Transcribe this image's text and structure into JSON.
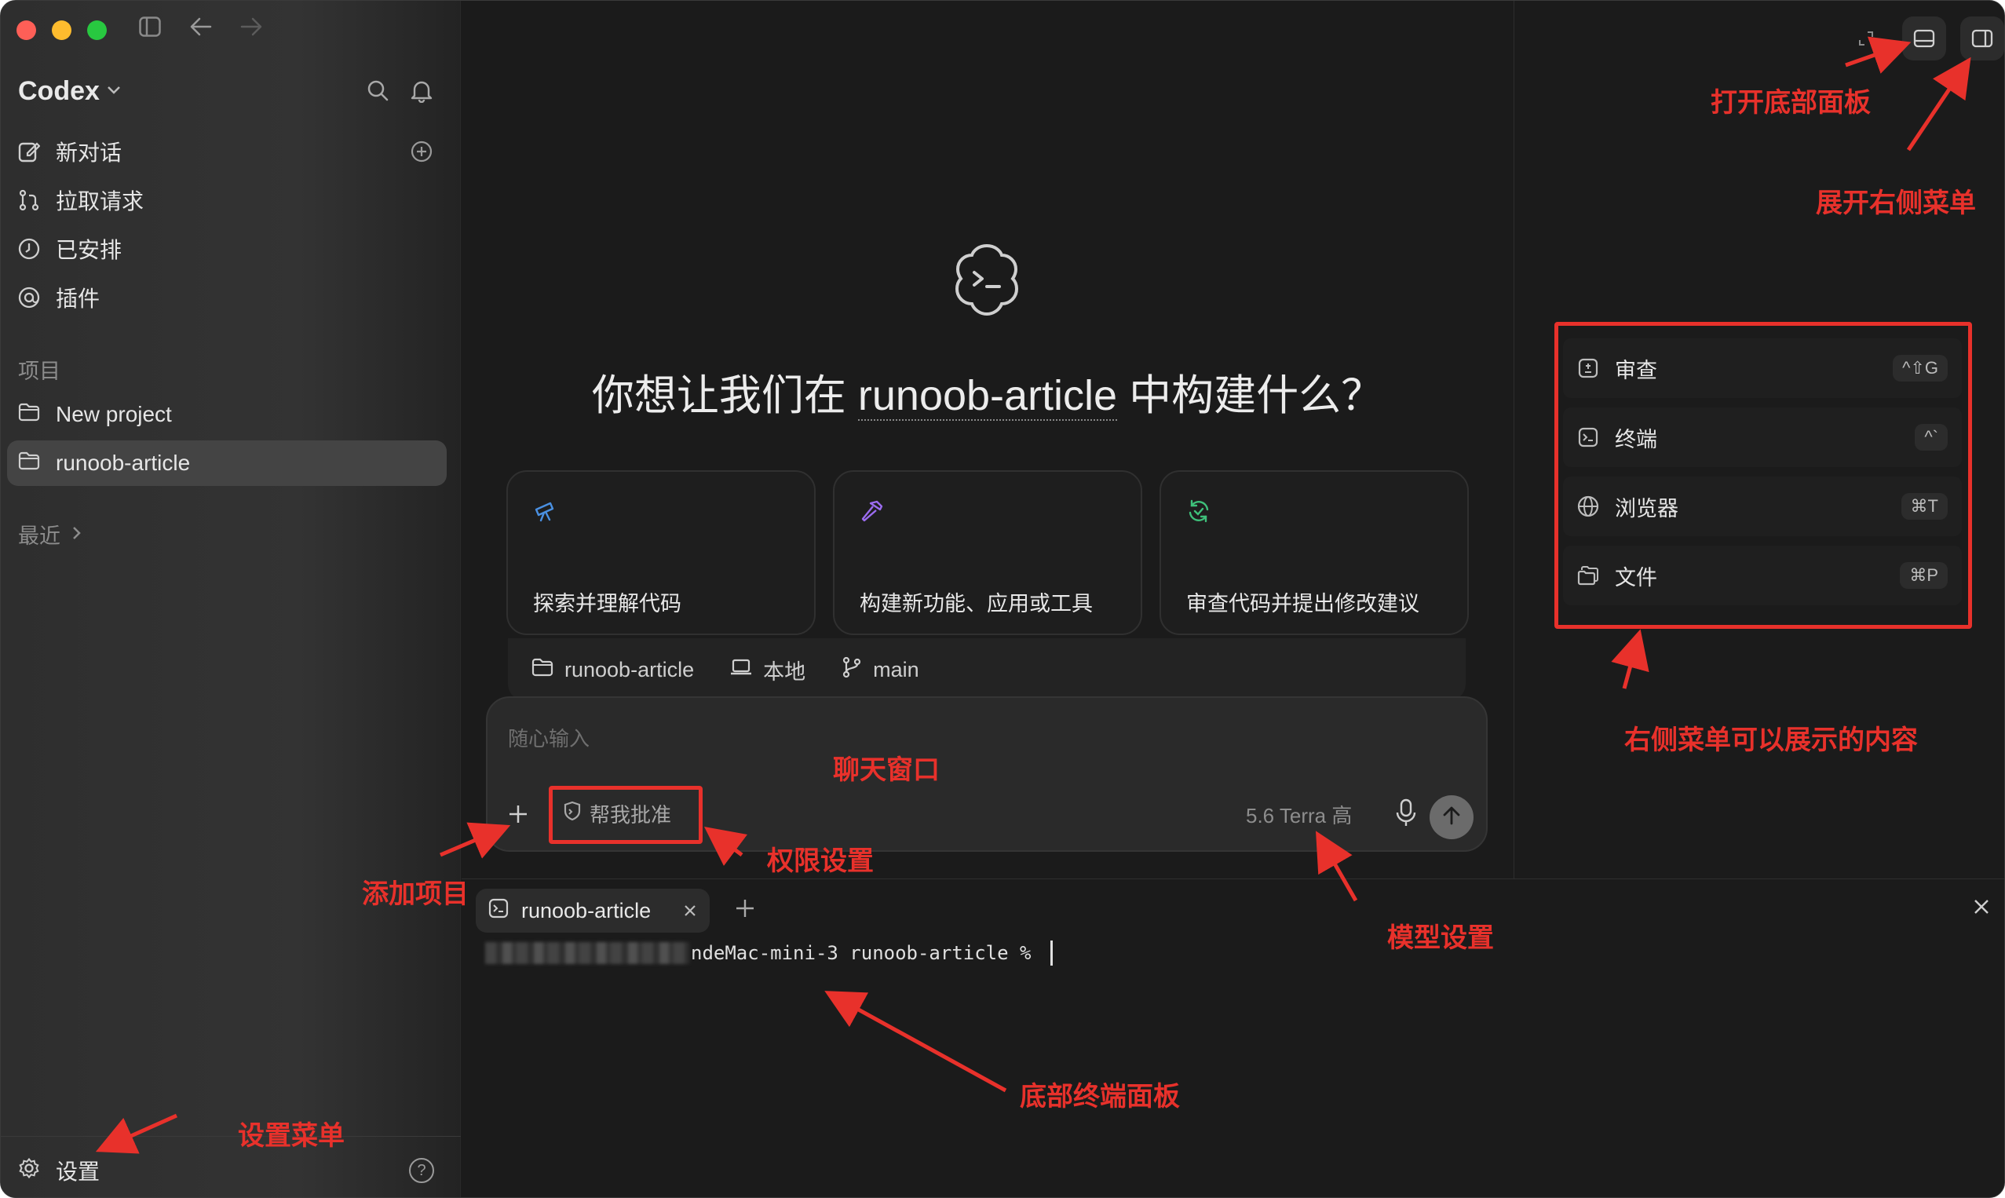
{
  "sidebar": {
    "app_name": "Codex",
    "nav": [
      {
        "label": "新对话",
        "icon": "edit-icon"
      },
      {
        "label": "拉取请求",
        "icon": "pull-request-icon"
      },
      {
        "label": "已安排",
        "icon": "clock-icon"
      },
      {
        "label": "插件",
        "icon": "plugin-icon"
      }
    ],
    "projects_label": "项目",
    "projects": [
      {
        "name": "New project",
        "active": false
      },
      {
        "name": "runoob-article",
        "active": true
      }
    ],
    "recent_label": "最近",
    "settings_label": "设置",
    "help_glyph": "?"
  },
  "main": {
    "headline_prefix": "你想让我们在 ",
    "headline_project": "runoob-article",
    "headline_suffix": " 中构建什么？",
    "cards": [
      {
        "label": "探索并理解代码",
        "icon": "telescope-icon",
        "color": "#4a90e2"
      },
      {
        "label": "构建新功能、应用或工具",
        "icon": "hammer-icon",
        "color": "#9b6cf0"
      },
      {
        "label": "审查代码并提出修改建议",
        "icon": "refresh-check-icon",
        "color": "#3ec07a"
      }
    ],
    "context": {
      "project": "runoob-article",
      "environment": "本地",
      "branch": "main"
    },
    "composer": {
      "placeholder": "随心输入",
      "approve_label": "帮我批准",
      "model_label": "5.6 Terra 高"
    }
  },
  "right_panel": {
    "menu": [
      {
        "label": "审查",
        "icon": "review-icon",
        "shortcut": "^⇧G"
      },
      {
        "label": "终端",
        "icon": "terminal-icon",
        "shortcut": "^`"
      },
      {
        "label": "浏览器",
        "icon": "globe-icon",
        "shortcut": "⌘T"
      },
      {
        "label": "文件",
        "icon": "files-icon",
        "shortcut": "⌘P"
      }
    ]
  },
  "terminal": {
    "tab_label": "runoob-article",
    "prompt": "ndeMac-mini-3 runoob-article % "
  },
  "annotations": {
    "open_bottom_panel": "打开底部面板",
    "expand_right_menu": "展开右侧菜单",
    "right_menu_content": "右侧菜单可以展示的内容",
    "chat_window": "聊天窗口",
    "permission_settings": "权限设置",
    "add_project": "添加项目",
    "model_settings": "模型设置",
    "bottom_terminal_panel": "底部终端面板",
    "settings_menu": "设置菜单"
  },
  "colors": {
    "annotation_red": "#e8312b",
    "background": "#1b1b1b",
    "sidebar": "#2f2f2f"
  }
}
